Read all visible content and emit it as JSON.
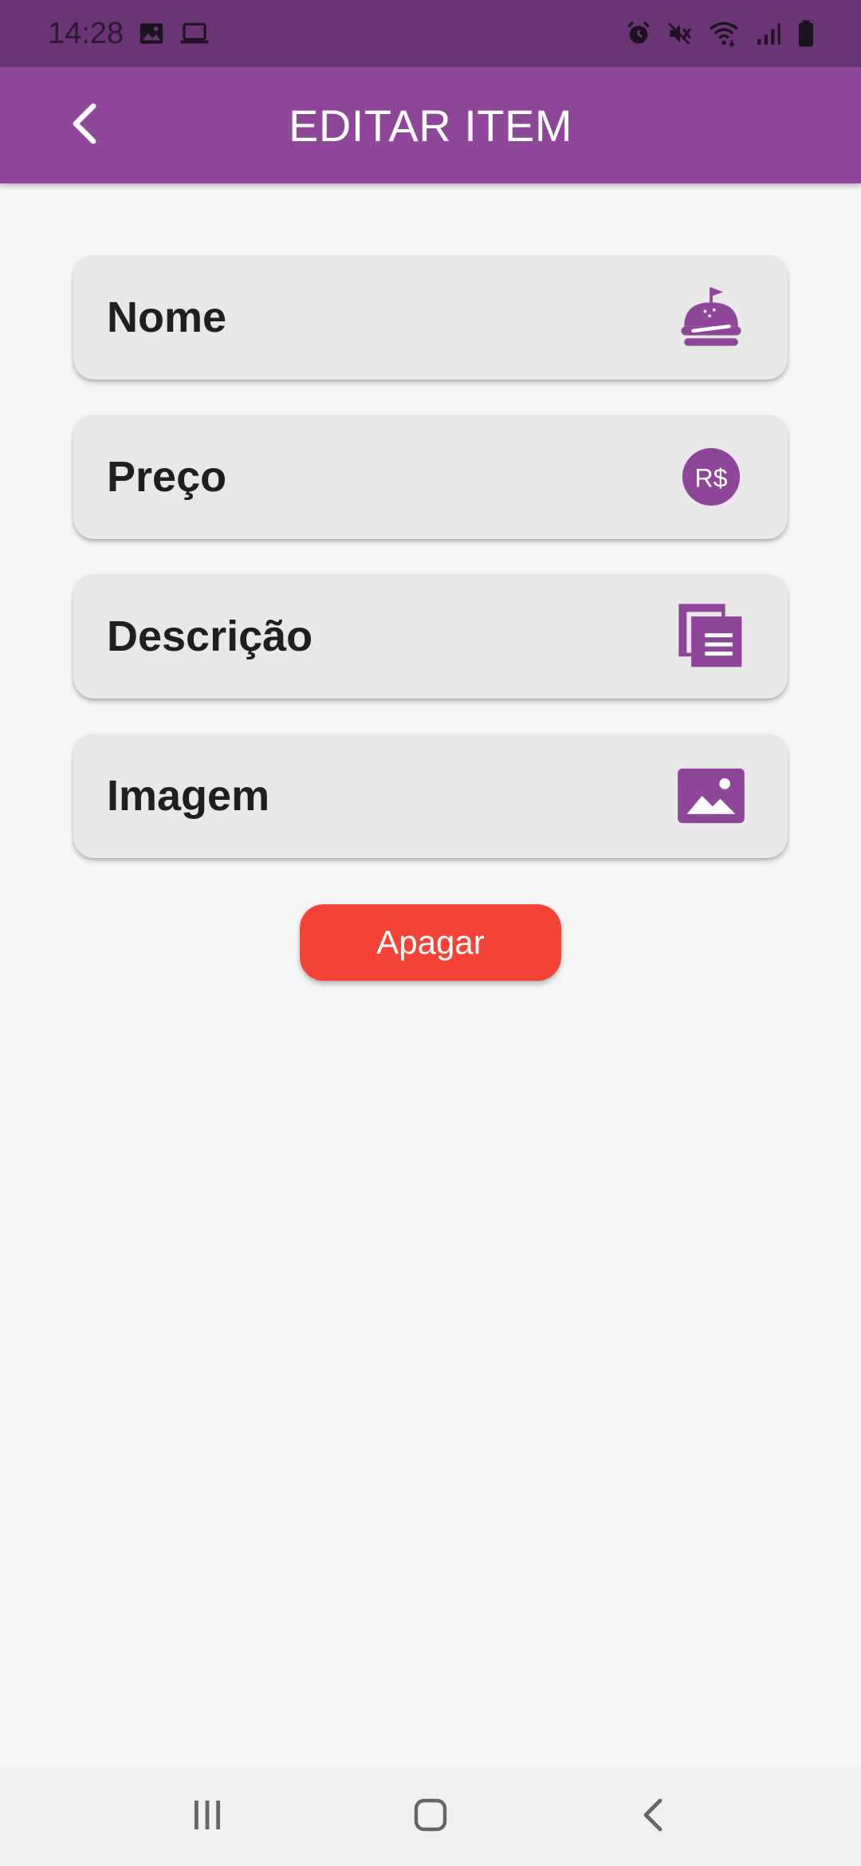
{
  "status_bar": {
    "time": "14:28",
    "left_icons": [
      "image-icon",
      "laptop-icon"
    ],
    "right_icons": [
      "alarm-icon",
      "mute-icon",
      "wifi-icon",
      "signal-icon",
      "battery-icon"
    ]
  },
  "app_bar": {
    "title": "EDITAR ITEM",
    "back_icon": "chevron-left-icon"
  },
  "form": {
    "fields": [
      {
        "label": "Nome",
        "icon": "food-icon"
      },
      {
        "label": "Preço",
        "icon": "currency-brl-icon"
      },
      {
        "label": "Descrição",
        "icon": "description-icon"
      },
      {
        "label": "Imagem",
        "icon": "image-icon"
      }
    ],
    "delete_label": "Apagar"
  },
  "nav_bar": {
    "icons": [
      "recent-apps-icon",
      "home-icon",
      "back-icon"
    ]
  },
  "colors": {
    "status_bar": "#6a3574",
    "app_bar": "#8e4699",
    "accent": "#8e4699",
    "delete": "#f44336",
    "background": "#f5f5f5",
    "card": "#e8e8e8"
  }
}
